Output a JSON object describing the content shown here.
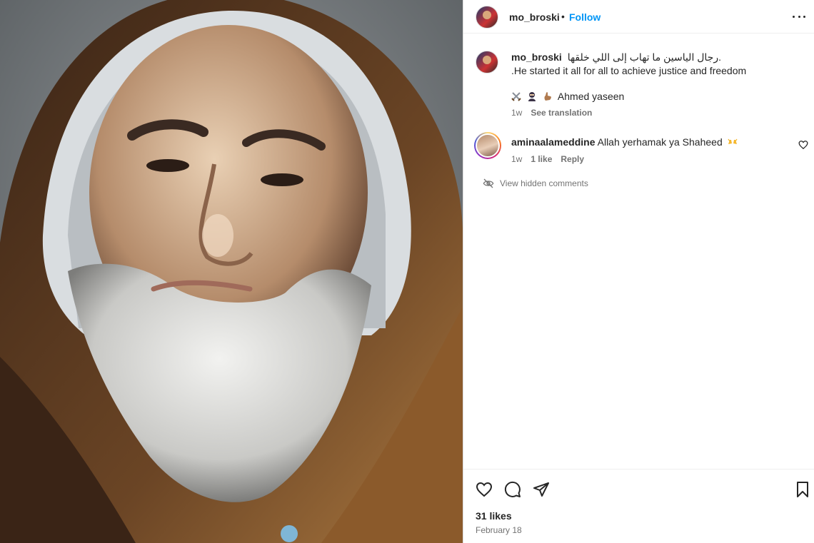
{
  "post": {
    "author": "mo_broski",
    "follow_label": "Follow",
    "separator": "•",
    "more_icon": "more-horizontal-icon",
    "likes": "31 likes",
    "date": "February 18"
  },
  "caption": {
    "username": "mo_broski",
    "arabic_text": "رجال الياسين ما تهاب إلى اللي خلقها.",
    "english_text": ".He started it all for all to achieve justice and freedom",
    "signature": "Ahmed yaseen",
    "emojis": [
      "crossed-swords-icon",
      "ninja-icon",
      "raised-hand-icon"
    ],
    "time": "1w",
    "see_translation": "See translation"
  },
  "comment": {
    "username": "aminaalameddine",
    "text": "Allah yerhamak ya Shaheed",
    "emoji": "raising-hands-icon",
    "time": "1w",
    "likes": "1 like",
    "reply": "Reply"
  },
  "hidden_comments": {
    "label": "View hidden comments"
  },
  "colors": {
    "link": "#0095f6",
    "muted": "#737373",
    "text": "#262626"
  }
}
